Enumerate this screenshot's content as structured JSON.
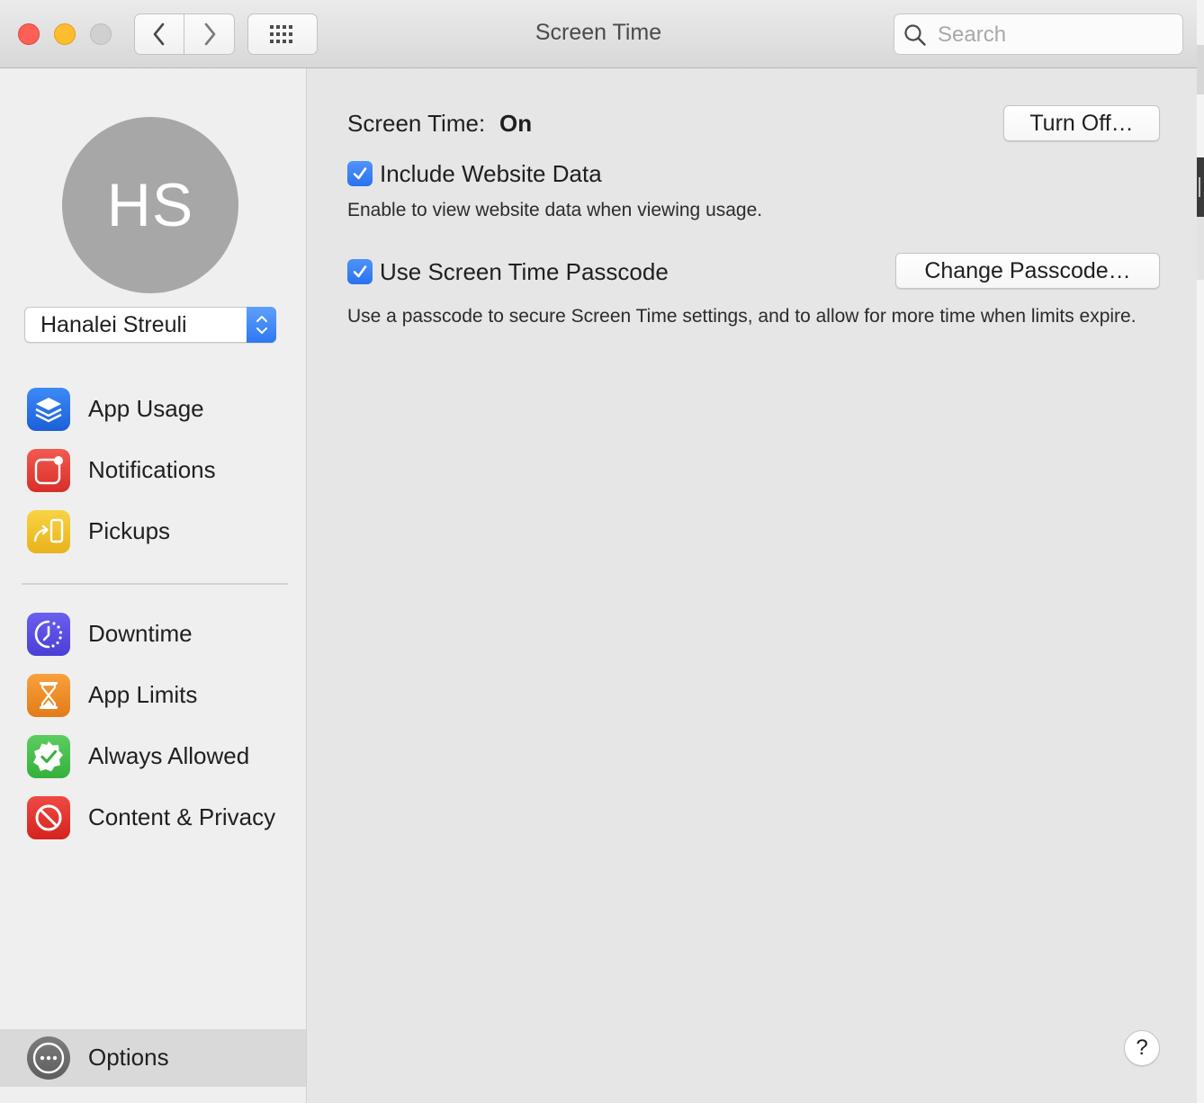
{
  "window": {
    "title": "Screen Time"
  },
  "search": {
    "placeholder": "Search"
  },
  "sidebar": {
    "avatar_initials": "HS",
    "user_select": {
      "selected": "Hanalei Streuli"
    },
    "items_top": [
      {
        "label": "App Usage",
        "icon": "app-usage-layers-icon"
      },
      {
        "label": "Notifications",
        "icon": "notifications-badge-icon"
      },
      {
        "label": "Pickups",
        "icon": "pickups-phone-arrow-icon"
      }
    ],
    "items_bottom": [
      {
        "label": "Downtime",
        "icon": "downtime-clock-icon"
      },
      {
        "label": "App Limits",
        "icon": "hourglass-icon"
      },
      {
        "label": "Always Allowed",
        "icon": "checkmark-badge-icon"
      },
      {
        "label": "Content & Privacy",
        "icon": "no-entry-icon"
      }
    ],
    "options_label": "Options"
  },
  "main": {
    "screen_time_label": "Screen Time:",
    "screen_time_value": "On",
    "turn_off_label": "Turn Off…",
    "include_website": {
      "label": "Include Website Data",
      "checked": true,
      "description": "Enable to view website data when viewing usage."
    },
    "passcode": {
      "label": "Use Screen Time Passcode",
      "checked": true,
      "description": "Use a passcode to secure Screen Time settings, and to allow for more time when limits expire.",
      "button_label": "Change Passcode…"
    },
    "help_label": "?"
  },
  "colors": {
    "accent": "#2f78f2",
    "close": "#fe5f57",
    "minimize": "#febc2e",
    "zoom_disabled": "#d0d0d0",
    "avatar": "#a7a7a7"
  }
}
